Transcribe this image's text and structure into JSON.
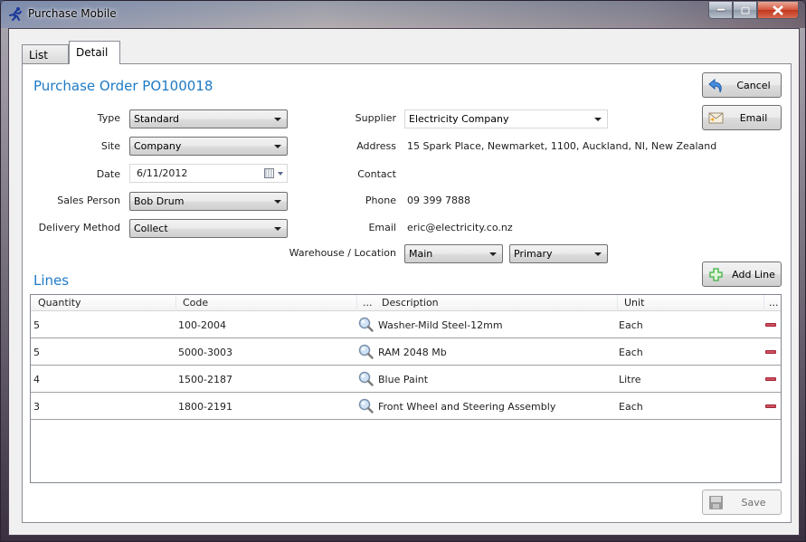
{
  "window": {
    "title": "Purchase Mobile",
    "controls": [
      "minimize",
      "maximize",
      "close"
    ]
  },
  "tabs": [
    {
      "label": "List",
      "active": false
    },
    {
      "label": "Detail",
      "active": true
    }
  ],
  "header": {
    "title": "Purchase Order PO100018"
  },
  "actions": {
    "cancel_label": "Cancel",
    "email_label": "Email",
    "add_line_label": "Add Line",
    "save_label": "Save"
  },
  "form_left": {
    "type": {
      "label": "Type",
      "value": "Standard"
    },
    "site": {
      "label": "Site",
      "value": "Company"
    },
    "date": {
      "label": "Date",
      "value": "6/11/2012"
    },
    "sales_person": {
      "label": "Sales Person",
      "value": "Bob Drum"
    },
    "delivery_method": {
      "label": "Delivery Method",
      "value": "Collect"
    }
  },
  "form_right": {
    "supplier": {
      "label": "Supplier",
      "value": "Electricity Company"
    },
    "address": {
      "label": "Address",
      "value": "15 Spark Place, Newmarket, 1100, Auckland, NI, New Zealand"
    },
    "contact": {
      "label": "Contact",
      "value": ""
    },
    "phone": {
      "label": "Phone",
      "value": "09 399 7888"
    },
    "email": {
      "label": "Email",
      "value": "eric@electricity.co.nz"
    },
    "warehouse_location": {
      "label": "Warehouse / Location",
      "warehouse": "Main",
      "location": "Primary"
    }
  },
  "lines": {
    "title": "Lines",
    "columns": {
      "quantity": "Quantity",
      "code": "Code",
      "lookup": "...",
      "description": "Description",
      "unit": "Unit",
      "actions": "..."
    },
    "rows": [
      {
        "quantity": "5",
        "code": "100-2004",
        "description": "Washer-Mild Steel-12mm",
        "unit": "Each"
      },
      {
        "quantity": "5",
        "code": "5000-3003",
        "description": "RAM 2048 Mb",
        "unit": "Each"
      },
      {
        "quantity": "4",
        "code": "1500-2187",
        "description": "Blue Paint",
        "unit": "Litre"
      },
      {
        "quantity": "3",
        "code": "1800-2191",
        "description": "Front Wheel and Steering Assembly",
        "unit": "Each"
      }
    ]
  },
  "colors": {
    "accent_title": "#1e7ac6",
    "delete_red": "#d05060",
    "add_green": "#3cb043"
  }
}
